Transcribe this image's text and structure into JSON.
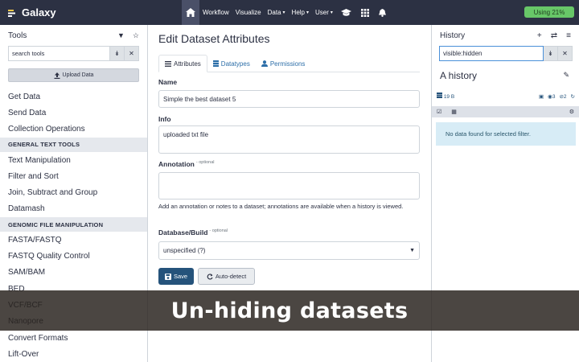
{
  "brand": {
    "name": "Galaxy"
  },
  "nav": {
    "items": [
      {
        "label": "Workflow",
        "dropdown": false
      },
      {
        "label": "Visualize",
        "dropdown": false
      },
      {
        "label": "Data",
        "dropdown": true
      },
      {
        "label": "Help",
        "dropdown": true
      },
      {
        "label": "User",
        "dropdown": true
      }
    ],
    "usage": "Using 21%"
  },
  "tools_panel": {
    "title": "Tools",
    "search_value": "search tools",
    "upload_label": "Upload Data",
    "items": [
      {
        "type": "tool",
        "label": "Get Data"
      },
      {
        "type": "tool",
        "label": "Send Data"
      },
      {
        "type": "tool",
        "label": "Collection Operations"
      },
      {
        "type": "section",
        "label": "GENERAL TEXT TOOLS"
      },
      {
        "type": "tool",
        "label": "Text Manipulation"
      },
      {
        "type": "tool",
        "label": "Filter and Sort"
      },
      {
        "type": "tool",
        "label": "Join, Subtract and Group"
      },
      {
        "type": "tool",
        "label": "Datamash"
      },
      {
        "type": "section",
        "label": "GENOMIC FILE MANIPULATION"
      },
      {
        "type": "tool",
        "label": "FASTA/FASTQ"
      },
      {
        "type": "tool",
        "label": "FASTQ Quality Control"
      },
      {
        "type": "tool",
        "label": "SAM/BAM"
      },
      {
        "type": "tool",
        "label": "BED"
      },
      {
        "type": "tool",
        "label": "VCF/BCF"
      },
      {
        "type": "tool",
        "label": "Nanopore"
      },
      {
        "type": "tool",
        "label": "Convert Formats"
      },
      {
        "type": "tool",
        "label": "Lift-Over"
      }
    ]
  },
  "center": {
    "title": "Edit Dataset Attributes",
    "tabs": [
      {
        "label": "Attributes",
        "active": true
      },
      {
        "label": "Datatypes",
        "active": false
      },
      {
        "label": "Permissions",
        "active": false
      }
    ],
    "form": {
      "name_label": "Name",
      "name_value": "Simple the best dataset 5",
      "info_label": "Info",
      "info_value": "uploaded txt file",
      "annotation_label": "Annotation",
      "annotation_optional": "- optional",
      "annotation_value": "",
      "annotation_help": "Add an annotation or notes to a dataset; annotations are available when a history is viewed.",
      "dbkey_label": "Database/Build",
      "dbkey_optional": "- optional",
      "dbkey_value": "unspecified (?)"
    },
    "save_label": "Save",
    "autodetect_label": "Auto-detect"
  },
  "history": {
    "title": "History",
    "filter_value": "visible:hidden",
    "name": "A history",
    "size": "19 B",
    "count_deleted": "3",
    "count_hidden": "2",
    "empty_message": "No data found for selected filter."
  },
  "banner": {
    "text": "Un-hiding datasets"
  }
}
